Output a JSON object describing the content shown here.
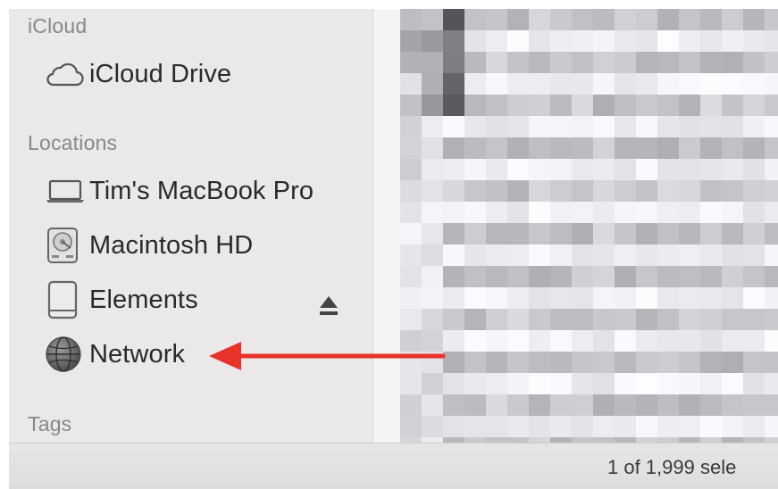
{
  "sidebar": {
    "icloud_heading": "iCloud",
    "icloud_items": [
      {
        "label": "iCloud Drive",
        "icon": "cloud-icon"
      }
    ],
    "locations_heading": "Locations",
    "location_items": [
      {
        "label": "Tim's MacBook Pro",
        "icon": "laptop-icon"
      },
      {
        "label": "Macintosh HD",
        "icon": "hard-drive-icon"
      },
      {
        "label": "Elements",
        "icon": "external-drive-icon",
        "eject": true
      },
      {
        "label": "Network",
        "icon": "network-globe-icon"
      }
    ],
    "tags_heading": "Tags"
  },
  "status_bar": {
    "text": "1 of 1,999 sele"
  },
  "annotation": {
    "arrow_color": "#e8322a"
  }
}
